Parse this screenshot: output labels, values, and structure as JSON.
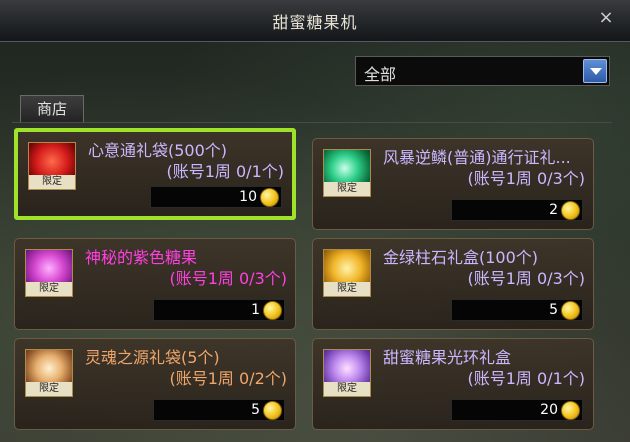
{
  "window": {
    "title": "甜蜜糖果机",
    "close_glyph": "×"
  },
  "filter": {
    "selected": "全部"
  },
  "tabs": [
    {
      "label": "商店"
    }
  ],
  "items": [
    {
      "name": "心意通礼袋(500个)",
      "limit": "(账号1周 0/1个)",
      "price": "10",
      "badge": "限定",
      "name_color": "#c9b8ff",
      "icon": "red-gift-bag-icon",
      "selected": true
    },
    {
      "name": "风暴逆鳞(普通)通行证礼...",
      "limit": "(账号1周 0/3个)",
      "price": "2",
      "badge": "限定",
      "name_color": "#c9b8ff",
      "icon": "green-dragon-scale-icon",
      "selected": false
    },
    {
      "name": "神秘的紫色糖果",
      "limit": "(账号1周 0/3个)",
      "price": "1",
      "badge": "限定",
      "name_color": "#ff3fe0",
      "icon": "purple-heart-candy-icon",
      "selected": false
    },
    {
      "name": "金绿柱石礼盒(100个)",
      "limit": "(账号1周 0/3个)",
      "price": "5",
      "badge": "限定",
      "name_color": "#c9b8ff",
      "icon": "gold-gem-box-icon",
      "selected": false
    },
    {
      "name": "灵魂之源礼袋(5个)",
      "limit": "(账号1周 0/2个)",
      "price": "5",
      "badge": "限定",
      "name_color": "#f0a66a",
      "icon": "soul-source-bag-icon",
      "selected": false
    },
    {
      "name": "甜蜜糖果光环礼盒",
      "limit": "(账号1周 0/1个)",
      "price": "20",
      "badge": "限定",
      "name_color": "#c9b8ff",
      "icon": "candy-aura-box-icon",
      "selected": false
    }
  ]
}
